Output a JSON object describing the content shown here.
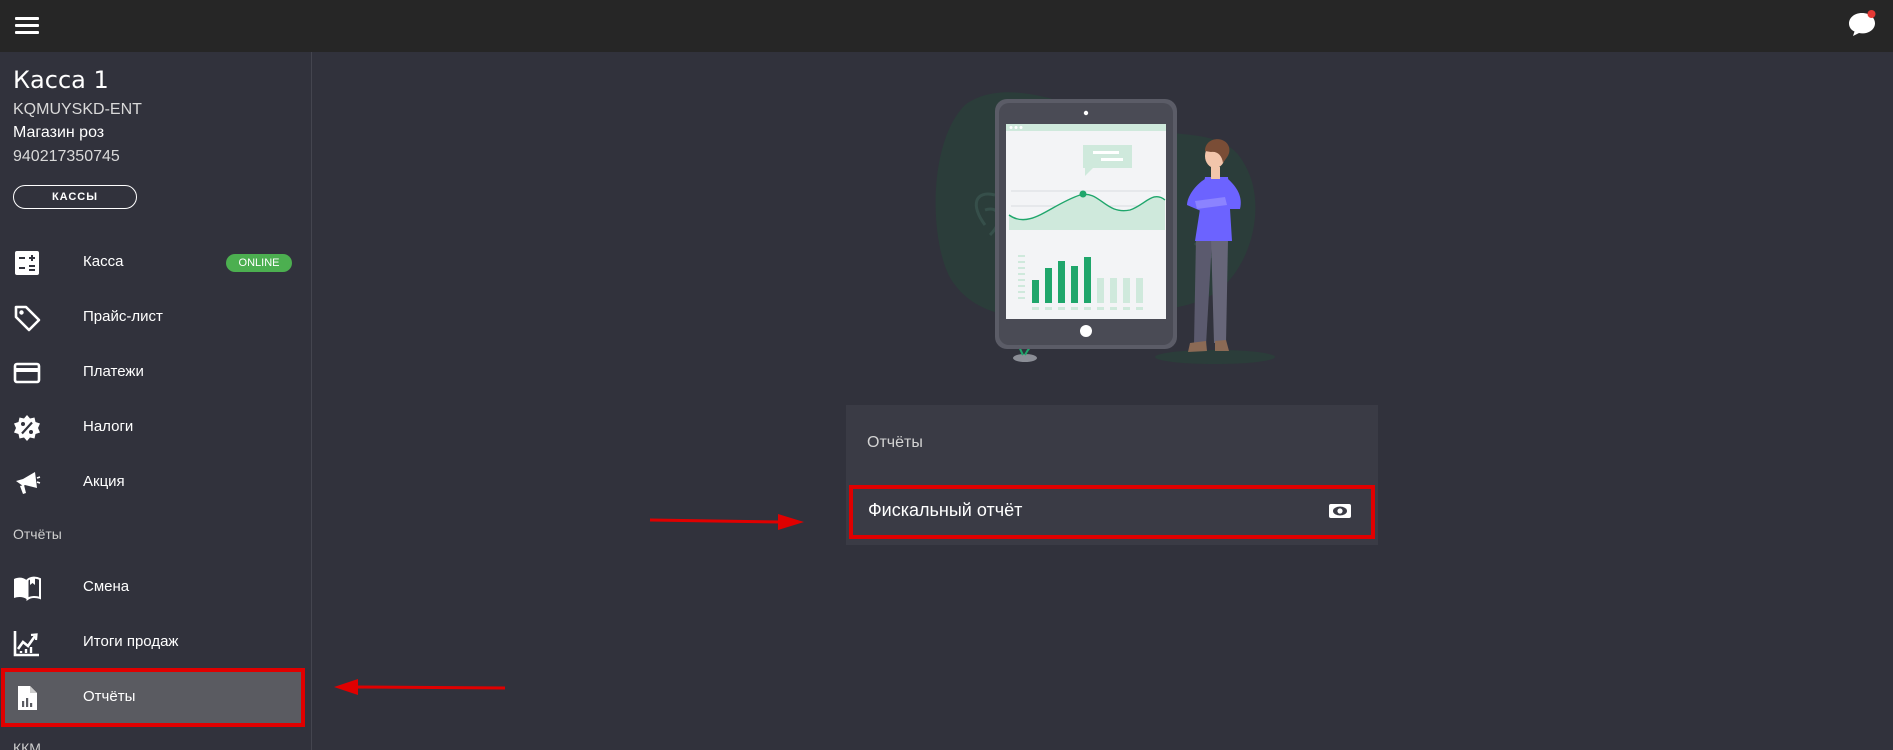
{
  "sidebar": {
    "title": "Касса 1",
    "device": "KQMUYSKD-ENT",
    "shop": "Магазин роз",
    "inn": "940217350745",
    "kassy_btn": "КАССЫ",
    "items": [
      {
        "label": "Касса",
        "icon": "calculator-icon",
        "badge": "ONLINE"
      },
      {
        "label": "Прайс-лист",
        "icon": "price-tag-icon"
      },
      {
        "label": "Платежи",
        "icon": "credit-card-icon"
      },
      {
        "label": "Налоги",
        "icon": "percent-badge-icon"
      },
      {
        "label": "Акция",
        "icon": "megaphone-icon"
      }
    ],
    "section_reports": "Отчёты",
    "report_items": [
      {
        "label": "Смена",
        "icon": "book-open-icon"
      },
      {
        "label": "Итоги продаж",
        "icon": "trending-chart-icon"
      },
      {
        "label": "Отчёты",
        "icon": "report-file-icon",
        "active": true
      }
    ],
    "section_kkm": "ККМ"
  },
  "main": {
    "card_title": "Отчёты",
    "fiscal_report": "Фискальный отчёт"
  },
  "colors": {
    "background": "#31323c",
    "topbar": "#262626",
    "online": "#4caf50",
    "highlight": "#e00000",
    "accent_green": "#1fa66b"
  }
}
